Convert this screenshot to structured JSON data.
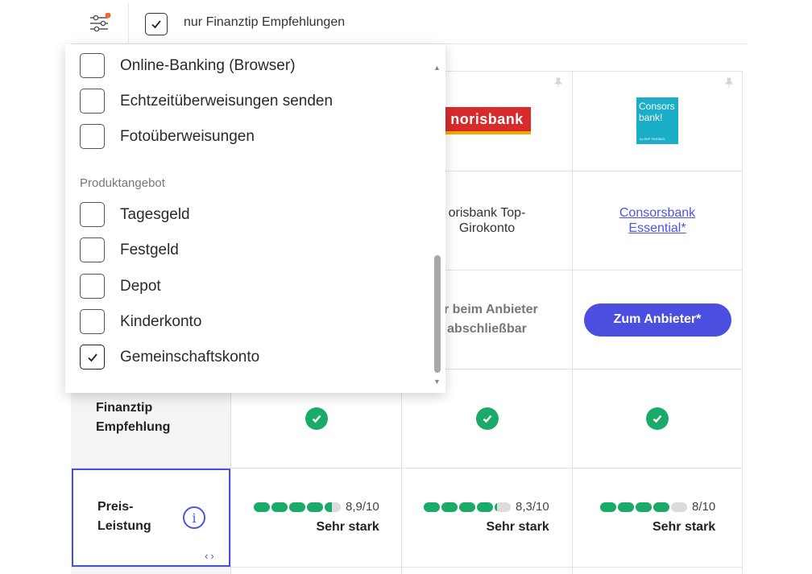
{
  "filter_bar": {
    "recommendation_label": "nur Finanztip Empfehlungen",
    "recommendation_checked": true
  },
  "dropdown": {
    "features": [
      {
        "label": "Online-Banking (Browser)",
        "checked": false
      },
      {
        "label": "Echtzeitüberweisungen senden",
        "checked": false
      },
      {
        "label": "Fotoüberweisungen",
        "checked": false
      }
    ],
    "section_title": "Produktangebot",
    "products": [
      {
        "label": "Tagesgeld",
        "checked": false
      },
      {
        "label": "Festgeld",
        "checked": false
      },
      {
        "label": "Depot",
        "checked": false
      },
      {
        "label": "Kinderkonto",
        "checked": false
      },
      {
        "label": "Gemeinschaftskonto",
        "checked": true
      }
    ]
  },
  "banks": [
    {
      "logo_text": "norisbank",
      "product_name": "orisbank Top-Girokonto",
      "cta_text": "ur beim Anbieter abschließbar",
      "recommended": true,
      "score": "8,9/10",
      "score_value": 8.9,
      "rating": "Sehr stark"
    },
    {
      "logo_text": "norisbank",
      "product_name": "orisbank Top-Girokonto",
      "cta_text": "ur beim Anbieter abschließbar",
      "recommended": true,
      "score": "8,3/10",
      "score_value": 8.3,
      "rating": "Sehr stark"
    },
    {
      "logo_line1": "Consors",
      "logo_line2": "bank!",
      "logo_sub": "by BNP PARIBAS",
      "product_link_line1": "Consorsbank",
      "product_link_line2": "Essential*",
      "cta_button": "Zum Anbieter*",
      "recommended": true,
      "score": "8/10",
      "score_value": 8.0,
      "rating": "Sehr stark"
    }
  ],
  "rows": {
    "recommendation_line1": "Finanztip",
    "recommendation_line2": "Empfehlung",
    "price_line1": "Preis-",
    "price_line2": "Leistung"
  },
  "icons": {
    "filter": "sliders-icon",
    "pin": "pin-icon",
    "check": "check-circle-icon",
    "info": "info-icon",
    "nav": "chevron-left-right-icon"
  },
  "colors": {
    "accent": "#4a4fe0",
    "success": "#1aaa6a",
    "notification_dot": "#f06a2a"
  }
}
